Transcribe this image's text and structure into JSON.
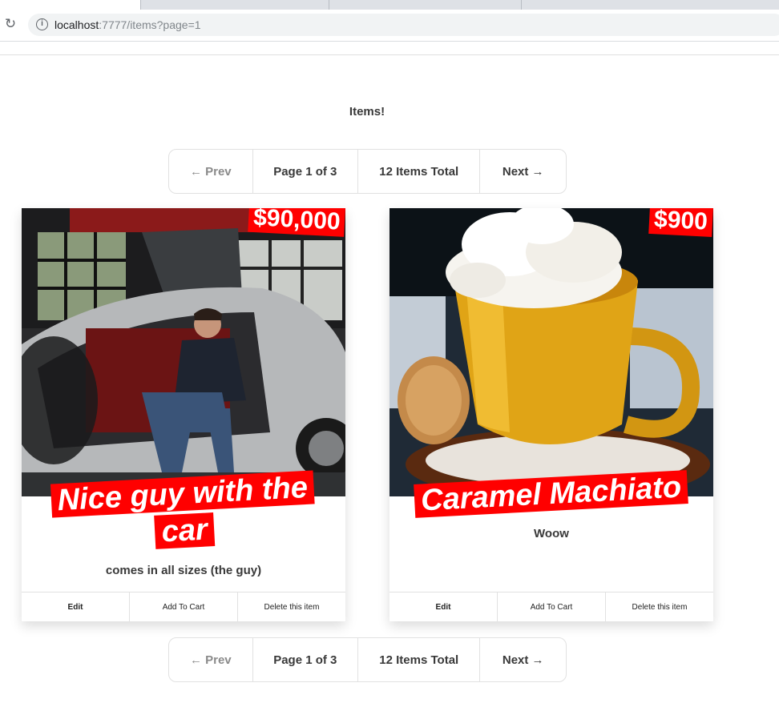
{
  "browser": {
    "url_host": "localhost",
    "url_path": ":7777/items?page=1"
  },
  "page": {
    "title": "Items!"
  },
  "pagination": {
    "prev": "← Prev",
    "page_info": "Page 1 of 3",
    "total": "12 Items Total",
    "next": "Next →"
  },
  "items": [
    {
      "price": "$90,000",
      "title": "Nice guy with the car",
      "description": "comes in all sizes (the guy)",
      "edit": "Edit",
      "add_to_cart": "Add To Cart",
      "delete": "Delete this item"
    },
    {
      "price": "$900",
      "title": "Caramel Machiato",
      "description": "Woow",
      "edit": "Edit",
      "add_to_cart": "Add To Cart",
      "delete": "Delete this item"
    }
  ],
  "colors": {
    "accent": "#ff0000",
    "text": "#393939",
    "border": "#e1e1e1"
  }
}
